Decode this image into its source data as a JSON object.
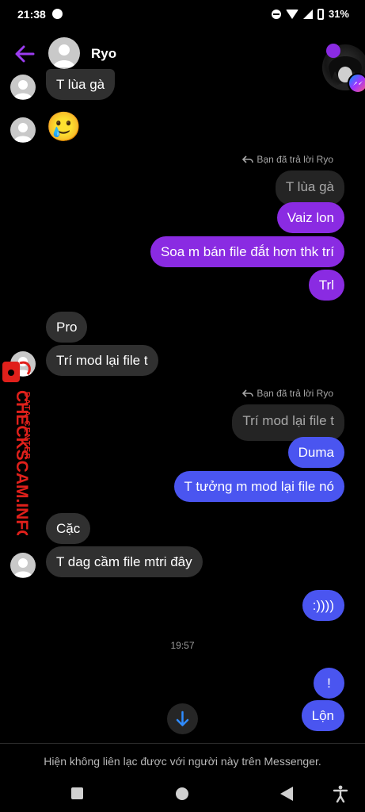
{
  "status_bar": {
    "time": "21:38",
    "battery": "31%"
  },
  "header": {
    "contact_name": "Ryo"
  },
  "messages": [
    {
      "text": "T lùa gà"
    },
    {
      "text": "🥲"
    },
    {
      "text": "Bạn đã trả lời Ryo"
    },
    {
      "text": "T lùa gà"
    },
    {
      "text": "Vaiz lon"
    },
    {
      "text": "Soa m bán file đắt hơn thk trí"
    },
    {
      "text": "Trl"
    },
    {
      "text": "Pro"
    },
    {
      "text": "Trí mod lại file t"
    },
    {
      "text": "Bạn đã trả lời Ryo"
    },
    {
      "text": "Trí mod lại file t"
    },
    {
      "text": "Duma"
    },
    {
      "text": "T tưởng m mod lại file nó"
    },
    {
      "text": "Cặc"
    },
    {
      "text": "T dag cầm file mtri đây"
    },
    {
      "text": ":))))"
    },
    {
      "text": "19:57"
    },
    {
      "text": "!"
    },
    {
      "text": "Lộn"
    }
  ],
  "watermark": {
    "brand": "CHECKSCAM.INFO",
    "sub": "DATA CENTER"
  },
  "footer": {
    "notice": "Hiện không liên lạc được với người này trên Messenger."
  },
  "colors": {
    "purple": "#8a2be2",
    "blue": "#4a55f0",
    "incoming": "#303030",
    "watermark": "#e0201b"
  }
}
